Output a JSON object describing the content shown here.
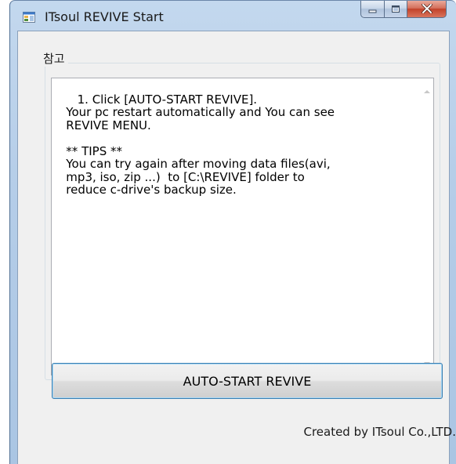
{
  "window": {
    "title": "ITsoul REVIVE Start",
    "accent_color": "#b5cde8",
    "close_color": "#c2422a"
  },
  "caption_buttons": {
    "minimize_icon": "minimize-icon",
    "maximize_icon": "maximize-icon",
    "close_icon": "close-icon"
  },
  "group": {
    "label": "참고"
  },
  "notes": {
    "text": "1. Click [AUTO-START REVIVE].\n   Your pc restart automatically and You can see\n   REVIVE MENU.\n\n   ** TIPS **\n   You can try again after moving data files(avi,\n   mp3, iso, zip ...)  to [C:\\REVIVE] folder to\n   reduce c-drive's backup size."
  },
  "actions": {
    "start_label": "AUTO-START REVIVE"
  },
  "footer": {
    "credit": "Created by ITsoul Co.,LTD."
  }
}
